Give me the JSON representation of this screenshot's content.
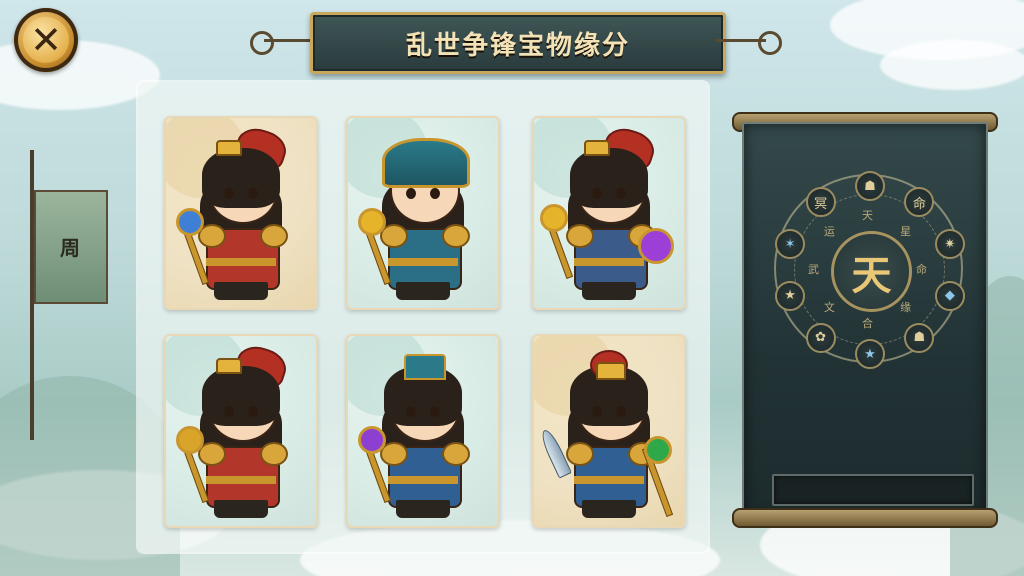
{
  "window": {
    "title": "乱世争锋宝物缘分"
  },
  "close_button": {
    "icon": "close-icon",
    "glyph": "✕"
  },
  "banner_flag": {
    "text": "周"
  },
  "collection": {
    "cards": [
      {
        "name": "hero-card-1",
        "frame": "gold",
        "hero_style": "red-plume",
        "armor": "#b3362a",
        "staff_gem": "#3f7fd6",
        "weapon": "staff-left"
      },
      {
        "name": "hero-card-2",
        "frame": "jade",
        "hero_style": "helmet",
        "armor": "#2a6f86",
        "staff_gem": "#e5b42a",
        "weapon": "staff-left"
      },
      {
        "name": "hero-card-3",
        "frame": "jade",
        "hero_style": "red-plume",
        "armor": "#3b5b8a",
        "staff_gem": "#9b3fd6",
        "weapon": "staff-right"
      },
      {
        "name": "hero-card-4",
        "frame": "jade",
        "hero_style": "red-plume",
        "armor": "#b3362a",
        "staff_gem": "#d8a52a",
        "weapon": "staff-left"
      },
      {
        "name": "hero-card-5",
        "frame": "jade",
        "hero_style": "hat",
        "armor": "#2f5f93",
        "staff_gem": "#8c3fd0",
        "weapon": "staff-left"
      },
      {
        "name": "hero-card-6",
        "frame": "gold",
        "hero_style": "crown",
        "armor": "#2f5f93",
        "staff_gem": "#2fa84a",
        "weapon": "blade"
      }
    ]
  },
  "fate_wheel": {
    "center": "天",
    "inner_marks": [
      "天",
      "星",
      "命",
      "缘",
      "合",
      "文",
      "武",
      "运"
    ],
    "nodes": [
      {
        "glyph": "☗",
        "tone": "gold"
      },
      {
        "glyph": "命",
        "tone": "gold"
      },
      {
        "glyph": "✷",
        "tone": "gold"
      },
      {
        "glyph": "◆",
        "tone": "blue"
      },
      {
        "glyph": "☗",
        "tone": "gold"
      },
      {
        "glyph": "★",
        "tone": "blue"
      },
      {
        "glyph": "✿",
        "tone": "gold"
      },
      {
        "glyph": "★",
        "tone": "gold"
      },
      {
        "glyph": "✶",
        "tone": "blue"
      },
      {
        "glyph": "冥",
        "tone": "gold"
      }
    ],
    "input_value": ""
  },
  "colors": {
    "panel_bg": "#f0f6f4",
    "scroll_bg": "#223335",
    "gold_accent": "#c9a75c"
  }
}
